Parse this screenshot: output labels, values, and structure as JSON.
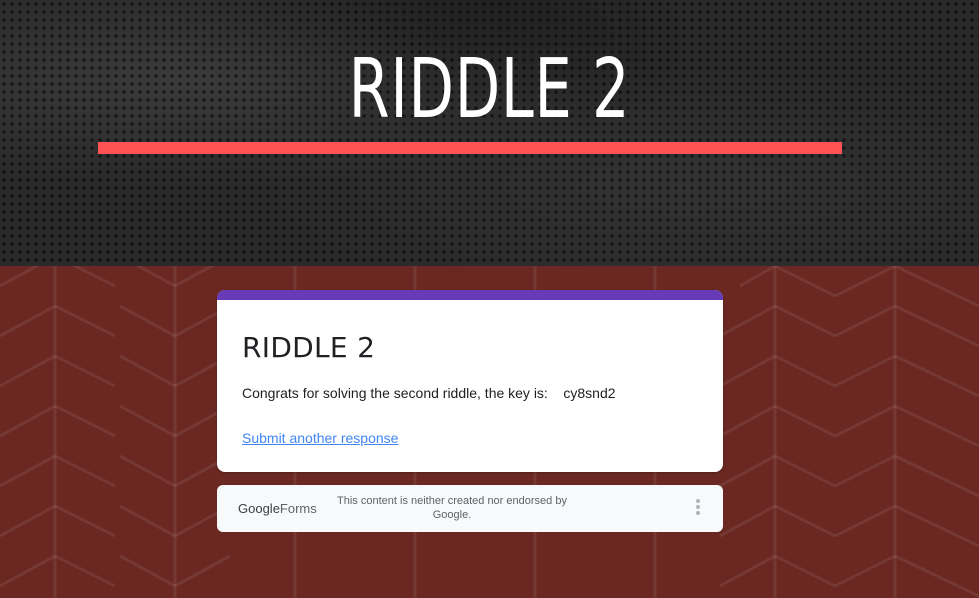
{
  "banner": {
    "title": "RIDDLE 2",
    "accent_color": "#ff5252"
  },
  "card": {
    "title": "RIDDLE 2",
    "message": "Congrats for solving the second riddle, the key is:    cy8snd2",
    "link_label": "Submit another response",
    "theme_color": "#673ab7"
  },
  "footer": {
    "logo_google": "Google",
    "logo_forms": "Forms",
    "note": "This content is neither created nor endorsed by Google.",
    "more_icon": "more-vertical-icon"
  },
  "colors": {
    "page_background": "#6b2822",
    "banner_background": "#2a2a2a",
    "link": "#4285f4"
  }
}
